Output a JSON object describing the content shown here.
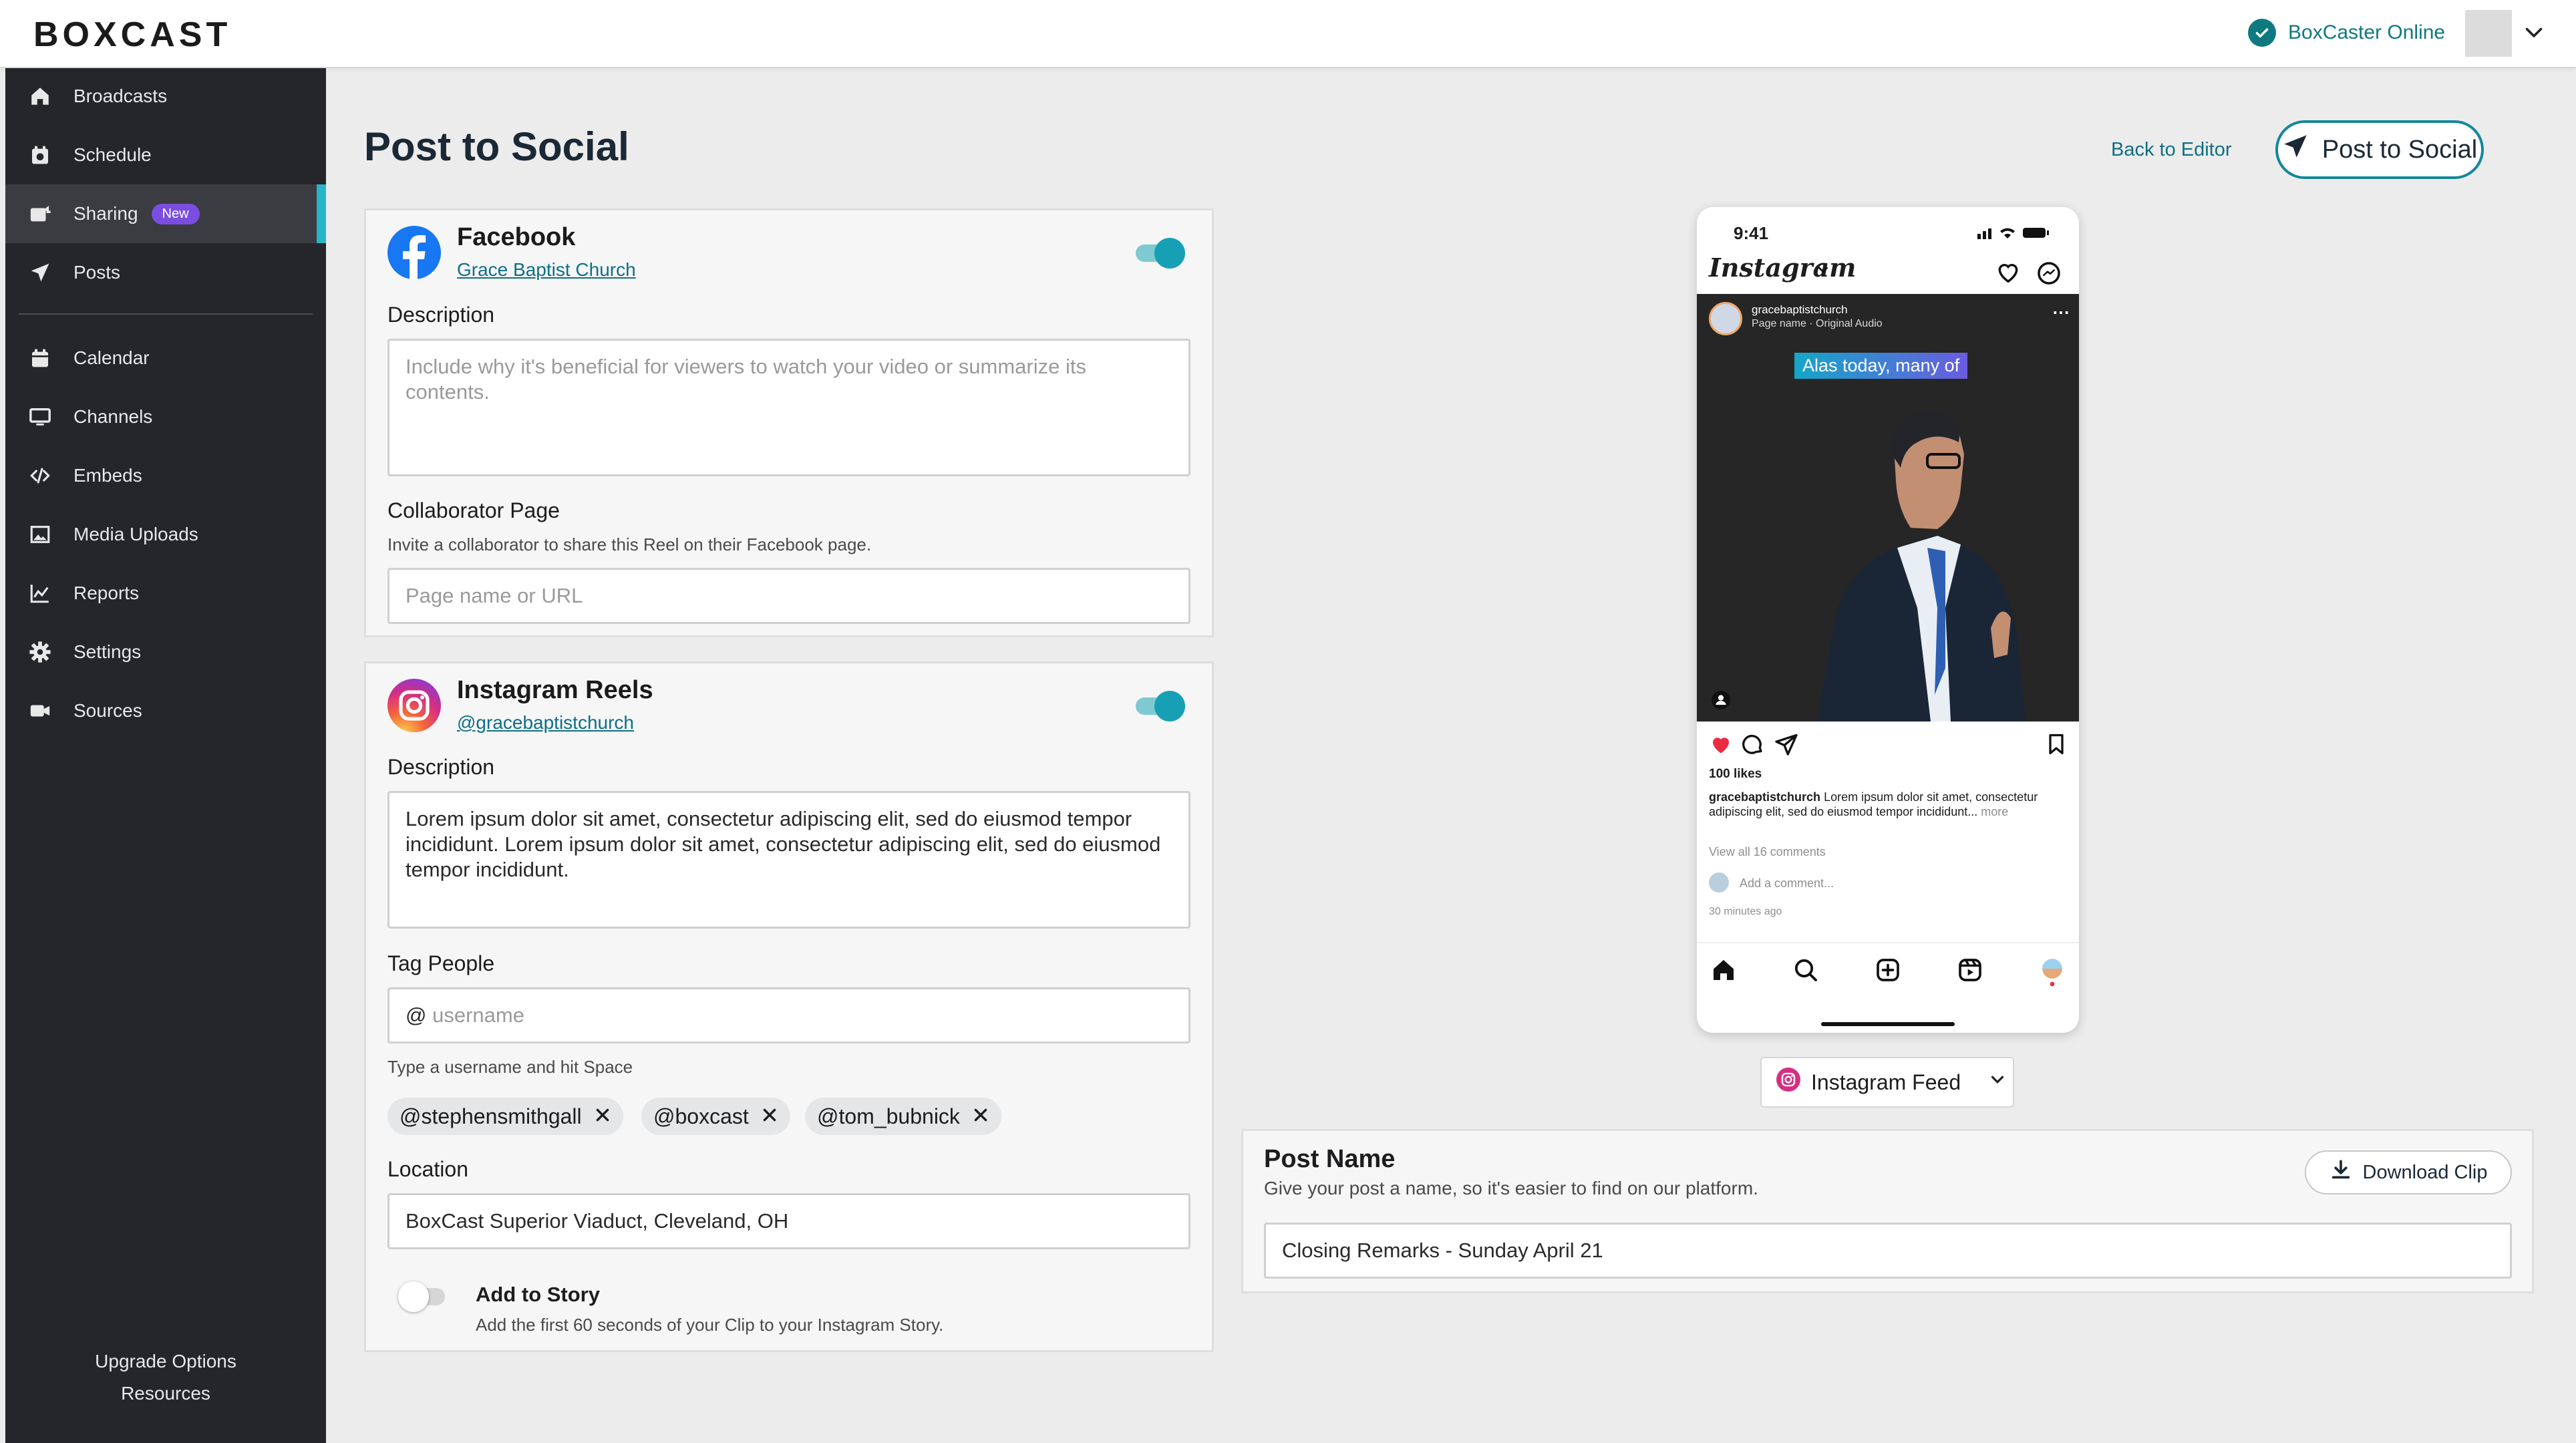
{
  "topbar": {
    "logo": "BOXCAST",
    "status": "BoxCaster Online"
  },
  "sidebar": {
    "items": [
      {
        "label": "Broadcasts",
        "icon": "home-icon"
      },
      {
        "label": "Schedule",
        "icon": "calendar-clock-icon"
      },
      {
        "label": "Sharing",
        "icon": "share-icon",
        "badge": "New",
        "active": true
      },
      {
        "label": "Posts",
        "icon": "send-icon"
      },
      {
        "label": "Calendar",
        "icon": "calendar-icon"
      },
      {
        "label": "Channels",
        "icon": "monitor-icon"
      },
      {
        "label": "Embeds",
        "icon": "code-icon"
      },
      {
        "label": "Media Uploads",
        "icon": "image-icon"
      },
      {
        "label": "Reports",
        "icon": "chart-icon"
      },
      {
        "label": "Settings",
        "icon": "gear-icon"
      },
      {
        "label": "Sources",
        "icon": "camera-icon"
      }
    ],
    "footer": {
      "upgrade": "Upgrade Options",
      "resources": "Resources"
    }
  },
  "header": {
    "title": "Post to Social",
    "back_link": "Back to Editor",
    "post_button": "Post to Social"
  },
  "facebook": {
    "name": "Facebook",
    "page": "Grace Baptist Church",
    "enabled": true,
    "description_label": "Description",
    "description_placeholder": "Include why it's beneficial for viewers to watch your video or summarize its contents.",
    "collab_label": "Collaborator Page",
    "collab_help": "Invite a collaborator to share this Reel on their Facebook page.",
    "collab_placeholder": "Page name or URL"
  },
  "instagram": {
    "name": "Instagram Reels",
    "handle": "@gracebaptistchurch",
    "enabled": true,
    "description_label": "Description",
    "description_value": "Lorem ipsum dolor sit amet, consectetur adipiscing elit, sed do eiusmod tempor incididunt. Lorem ipsum dolor sit amet, consectetur adipiscing elit, sed do eiusmod tempor incididunt.",
    "tag_label": "Tag People",
    "tag_prefix": "@",
    "tag_placeholder": "username",
    "tag_help": "Type a username and hit Space",
    "tags": [
      "@stephensmithgall",
      "@boxcast",
      "@tom_bubnick"
    ],
    "location_label": "Location",
    "location_value": "BoxCast Superior Viaduct, Cleveland, OH",
    "story_label": "Add to Story",
    "story_help": "Add the first 60 seconds of your Clip to your Instagram Story.",
    "story_enabled": false
  },
  "preview": {
    "time": "9:41",
    "app_name": "Instagram",
    "account": "gracebaptistchurch",
    "audio": "Page name · Original Audio",
    "caption_overlay": "Alas today, many of",
    "likes": "100 likes",
    "caption_user": "gracebaptistchurch",
    "caption_text": "Lorem ipsum dolor sit amet, consectetur adipiscing elit, sed do eiusmod tempor incididunt...",
    "more": "more",
    "comments": "View all 16 comments",
    "add_comment": "Add a comment...",
    "time_ago": "30 minutes ago",
    "feed_select": "Instagram Feed"
  },
  "post_name": {
    "label": "Post Name",
    "help": "Give your post a name, so it's easier to find on our platform.",
    "download": "Download Clip",
    "value": "Closing Remarks - Sunday April 21"
  },
  "colors": {
    "accent": "#13879a",
    "sidebar": "#24262a",
    "active_bar": "#27b6c9",
    "badge": "#7a4ee0"
  }
}
